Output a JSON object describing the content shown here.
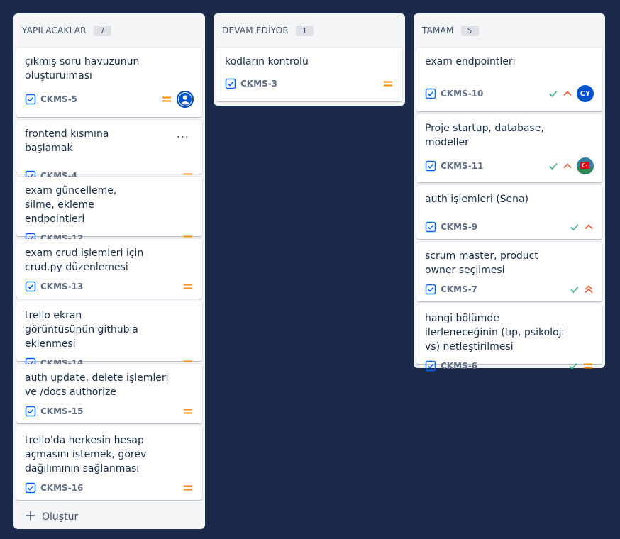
{
  "columns": [
    {
      "title": "YAPILACAKLAR",
      "count": "7",
      "create_label": "Oluştur",
      "cards": [
        {
          "title": "çıkmış soru havuzunun oluşturulması",
          "key": "CKMS-5"
        },
        {
          "title": "frontend kısmına başlamak",
          "key": "CKMS-4",
          "more": "..."
        },
        {
          "title": "exam güncelleme, silme, ekleme endpointleri",
          "key": "CKMS-12"
        },
        {
          "title": "exam crud işlemleri için crud.py düzenlemesi",
          "key": "CKMS-13"
        },
        {
          "title": "trello ekran görüntüsünün github'a eklenmesi",
          "key": "CKMS-14"
        },
        {
          "title": "auth update, delete işlemleri ve /docs authorize",
          "key": "CKMS-15"
        },
        {
          "title": "trello'da herkesin hesap açmasını istemek, görev dağılımının sağlanması",
          "key": "CKMS-16"
        }
      ]
    },
    {
      "title": "DEVAM EDİYOR",
      "count": "1",
      "cards": [
        {
          "title": "kodların kontrolü",
          "key": "CKMS-3"
        }
      ]
    },
    {
      "title": "TAMAM",
      "count": "5",
      "cards": [
        {
          "title": "exam endpointleri",
          "key": "CKMS-10",
          "avatar": "CY"
        },
        {
          "title": "Proje startup, database, modeller",
          "key": "CKMS-11"
        },
        {
          "title": "auth işlemleri (Sena)",
          "key": "CKMS-9"
        },
        {
          "title": "scrum master, product owner seçilmesi",
          "key": "CKMS-7"
        },
        {
          "title": "hangi bölümde ilerleneceğinin (tıp, psikoloji vs) netleştirilmesi",
          "key": "CKMS-6"
        }
      ]
    }
  ],
  "colors": {
    "background": "#1b2a4a",
    "column_bg": "#f4f5f7",
    "checkbox_blue": "#0065ff",
    "priority_medium": "#ff8b00",
    "priority_high": "#ff5630",
    "done_green": "#36b37e"
  },
  "icons": {
    "task": "checkbox-icon",
    "priority_medium": "equals-icon",
    "priority_high": "chevron-up-icon",
    "priority_highest": "double-chevron-up-icon",
    "done": "checkmark-icon",
    "create": "plus-icon"
  }
}
